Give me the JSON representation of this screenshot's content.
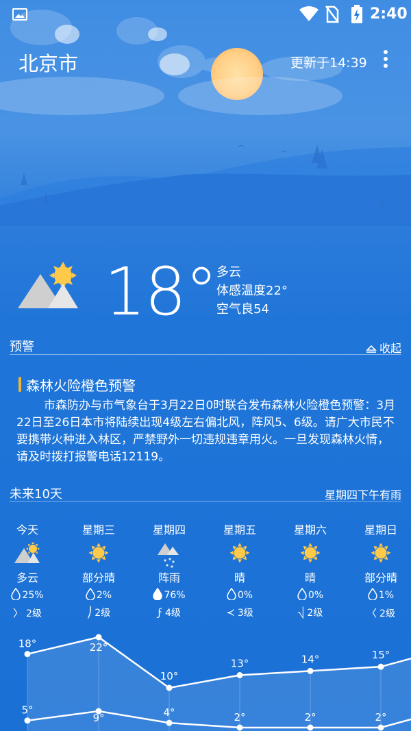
{
  "status_bar": {
    "time": "2:40",
    "icons": [
      "image-icon",
      "wifi-icon",
      "no-sim-icon",
      "battery-charging-icon"
    ]
  },
  "header": {
    "city": "北京市",
    "updated": "更新于14:39",
    "menu_icon": "more-vert-icon"
  },
  "current": {
    "temperature": "18°",
    "condition": "多云",
    "feels_like": "体感温度22°",
    "air_quality": "空气良54",
    "icon": "partly-cloudy-icon"
  },
  "alerts": {
    "section_title": "预警",
    "collapse_label": "收起",
    "title": "森林火险橙色预警",
    "body": "市森防办与市气象台于3月22日0时联合发布森林火险橙色预警：3月22日至26日本市将陆续出现4级左右偏北风，阵风5、6级。请广大市民不要携带火种进入林区，严禁野外一切违规违章用火。一旦发现森林火情，请及时拨打报警电话12119。",
    "accent_color": "#f2b632"
  },
  "forecast": {
    "section_title": "未来10天",
    "summary": "星期四下午有雨",
    "days": [
      {
        "name": "今天",
        "icon": "partly-cloudy-icon",
        "condition": "多云",
        "rain": "25%",
        "wind": "2级",
        "high": "18°",
        "low": "5°"
      },
      {
        "name": "星期三",
        "icon": "sunny-icon",
        "condition": "部分晴",
        "rain": "2%",
        "wind": "2级",
        "high": "22°",
        "low": "9°"
      },
      {
        "name": "星期四",
        "icon": "shower-icon",
        "condition": "阵雨",
        "rain": "76%",
        "wind": "4级",
        "high": "10°",
        "low": "4°"
      },
      {
        "name": "星期五",
        "icon": "sunny-icon",
        "condition": "晴",
        "rain": "0%",
        "wind": "3级",
        "high": "13°",
        "low": "2°"
      },
      {
        "name": "星期六",
        "icon": "sunny-icon",
        "condition": "晴",
        "rain": "0%",
        "wind": "2级",
        "high": "14°",
        "low": "2°"
      },
      {
        "name": "星期日",
        "icon": "sunny-icon",
        "condition": "部分晴",
        "rain": "1%",
        "wind": "2级",
        "high": "15°",
        "low": "2°"
      }
    ]
  },
  "chart_data": {
    "type": "line",
    "categories": [
      "今天",
      "星期三",
      "星期四",
      "星期五",
      "星期六",
      "星期日"
    ],
    "series": [
      {
        "values": [
          18,
          22,
          10,
          13,
          14,
          15
        ]
      },
      {
        "values": [
          5,
          9,
          4,
          2,
          2,
          2
        ]
      }
    ],
    "xlabel": "",
    "ylabel": ""
  },
  "colors": {
    "background": "#1a74d9",
    "sun": "#ffc94a",
    "rain_high": "#ffffff"
  }
}
